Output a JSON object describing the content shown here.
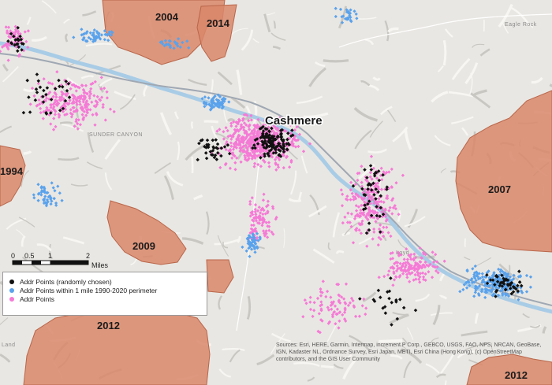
{
  "map": {
    "town_label": "Cashmere",
    "terrain_labels": [
      "SUNDER CANYON",
      "Eagle Rock",
      "Loyd",
      "Land"
    ],
    "fire_perimeters": [
      {
        "year": "2004"
      },
      {
        "year": "2014"
      },
      {
        "year": "1994"
      },
      {
        "year": "2007"
      },
      {
        "year": "2009"
      },
      {
        "year": "2012"
      },
      {
        "year": "2012"
      }
    ],
    "scale_bar": {
      "ticks": [
        "0",
        "0.5",
        "1",
        "2"
      ],
      "unit": "Miles"
    },
    "legend": {
      "items": [
        {
          "label": "Addr Points (randomly chosen)",
          "color": "#111111"
        },
        {
          "label": "Addr Points within 1 mile 1990-2020 perimeter",
          "color": "#5aa2ec"
        },
        {
          "label": "Addr Points",
          "color": "#f57ad6"
        }
      ]
    },
    "attribution": "Sources: Esri, HERE, Garmin, Intermap, increment P Corp., GEBCO, USGS, FAO, NPS, NRCAN, GeoBase, IGN, Kadaster NL, Ordnance Survey, Esri Japan, METI, Esri China (Hong Kong), (c) OpenStreetMap contributors, and the GIS User Community",
    "colors": {
      "background": "#e9e7e3",
      "fire": "#d9876a",
      "river": "#a9cce6",
      "road": "#9fa8b3",
      "addr_points": "#f57ad6",
      "near_perimeter": "#5aa2ec",
      "random": "#111111"
    }
  }
}
